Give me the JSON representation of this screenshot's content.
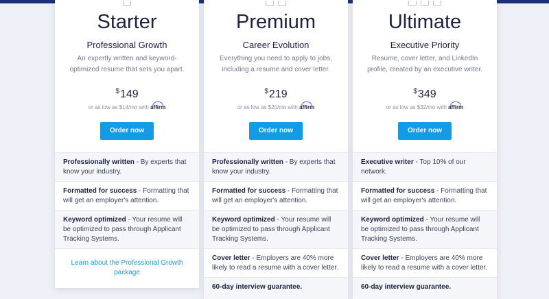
{
  "plans": [
    {
      "title": "Starter",
      "subtitle": "Professional Growth",
      "description": "An expertly written and keyword-optimized resume that sets you apart.",
      "currency": "$",
      "price": "149",
      "affirm_text": "or as low as $14/mo with",
      "affirm_brand": "affirm",
      "cta": "Order now",
      "features": [
        {
          "name": "Professionally written",
          "desc": " - By experts that know your industry."
        },
        {
          "name": "Formatted for success",
          "desc": " - Formatting that will get an employer's attention."
        },
        {
          "name": "Keyword optimized",
          "desc": " - Your resume will be optimized to pass through Applicant Tracking Systems."
        }
      ],
      "link": "Learn about the Professional Growth package"
    },
    {
      "title": "Premium",
      "subtitle": "Career Evolution",
      "description": "Everything you need to apply to jobs, including a resume and cover letter.",
      "currency": "$",
      "price": "219",
      "affirm_text": "or as low as $20/mo with",
      "affirm_brand": "affirm",
      "cta": "Order now",
      "features": [
        {
          "name": "Professionally written",
          "desc": " - By experts that know your industry."
        },
        {
          "name": "Formatted for success",
          "desc": " - Formatting that will get an employer's attention."
        },
        {
          "name": "Keyword optimized",
          "desc": " - Your resume will be optimized to pass through Applicant Tracking Systems."
        },
        {
          "name": "Cover letter",
          "desc": " - Employers are 40% more likely to read a resume with a cover letter."
        },
        {
          "name": "60-day interview guarantee.",
          "desc": ""
        }
      ]
    },
    {
      "title": "Ultimate",
      "subtitle": "Executive Priority",
      "description": "Resume, cover letter, and LinkedIn profile, created by an executive writer.",
      "currency": "$",
      "price": "349",
      "affirm_text": "or as low as $32/mo with",
      "affirm_brand": "affirm",
      "cta": "Order now",
      "features": [
        {
          "name": "Executive writer",
          "desc": " - Top 10% of our network."
        },
        {
          "name": "Formatted for success",
          "desc": " - Formatting that will get an employer's attention."
        },
        {
          "name": "Keyword optimized",
          "desc": " - Your resume will be optimized to pass through Applicant Tracking Systems."
        },
        {
          "name": "Cover letter",
          "desc": " - Employers are 40% more likely to read a resume with a cover letter."
        },
        {
          "name": "60-day interview guarantee.",
          "desc": ""
        }
      ]
    }
  ],
  "colors": {
    "accent": "#139be8",
    "band": "#1b2f7a",
    "background": "#edf0f6"
  }
}
